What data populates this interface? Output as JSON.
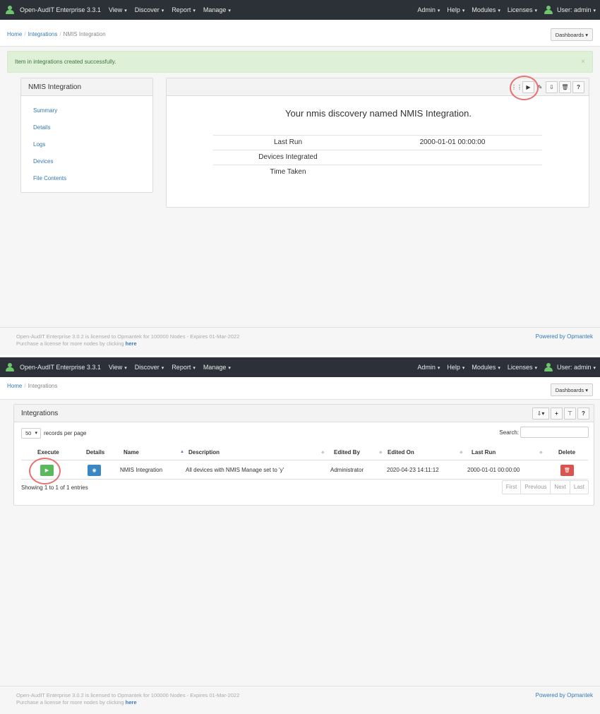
{
  "navbar": {
    "brand": "Open-AudIT Enterprise 3.3.1",
    "menu": [
      "View",
      "Discover",
      "Report",
      "Manage"
    ],
    "right_menu": [
      "Admin",
      "Help",
      "Modules",
      "Licenses"
    ],
    "user": "User: admin"
  },
  "top": {
    "breadcrumb": {
      "home": "Home",
      "integrations": "Integrations",
      "current": "NMIS Integration"
    },
    "dashboards_label": "Dashboards",
    "alert": {
      "text": "Item in integrations created successfully.",
      "close": "×"
    },
    "side_panel": {
      "title": "NMIS Integration",
      "links": [
        "Summary",
        "Details",
        "Logs",
        "Devices",
        "File Contents"
      ]
    },
    "main_panel": {
      "heading": "Your nmis discovery named NMIS Integration.",
      "rows": [
        {
          "label": "Last Run",
          "value": "2000-01-01 00:00:00"
        },
        {
          "label": "Devices Integrated",
          "value": ""
        },
        {
          "label": "Time Taken",
          "value": ""
        }
      ]
    }
  },
  "bottom": {
    "breadcrumb": {
      "home": "Home",
      "current": "Integrations"
    },
    "dashboards_label": "Dashboards",
    "panel_title": "Integrations",
    "records_value": "50",
    "records_label": "records per page",
    "search_label": "Search:",
    "columns": [
      "Execute",
      "Details",
      "Name",
      "Description",
      "Edited By",
      "Edited On",
      "Last Run",
      "Delete"
    ],
    "row": {
      "name": "NMIS Integration",
      "description": "All devices with NMIS Manage set to 'y'",
      "edited_by": "Administrator",
      "edited_on": "2020-04-23 14:11:12",
      "last_run": "2000-01-01 00:00:00"
    },
    "showing": "Showing 1 to 1 of 1 entries",
    "pager": [
      "First",
      "Previous",
      "Next",
      "Last"
    ]
  },
  "footer": {
    "license_line1": "Open-AudIT Enterprise 3.0.2 is licensed to Opmantek for 100000 Nodes - Expires 01-Mar-2022",
    "license_line2": "Purchase a license for more nodes by clicking",
    "license_link": "here",
    "powered": "Powered by Opmantek"
  },
  "colors": {
    "navbar": "#2b3137",
    "link": "#337ab7",
    "success": "#5cb85c",
    "danger": "#d9534f",
    "highlight_ring": "#ea7070"
  }
}
